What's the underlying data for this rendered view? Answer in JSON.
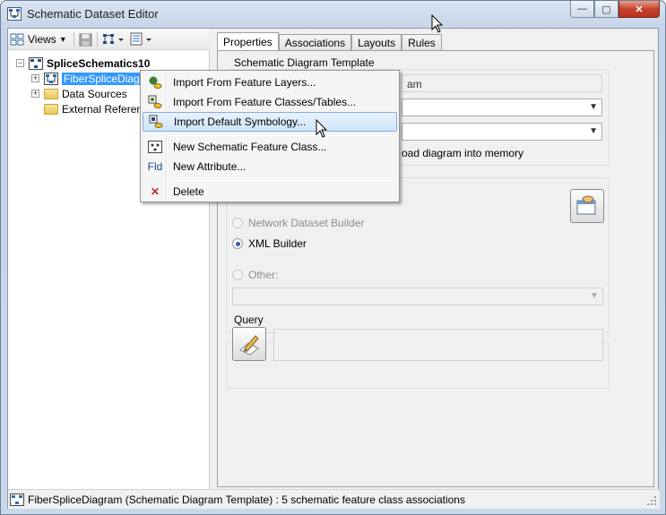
{
  "window": {
    "title": "Schematic Dataset Editor",
    "buttons": {
      "minimize": "—",
      "maximize": "▢",
      "close": "✕"
    }
  },
  "toolbar": {
    "views_label": "Views",
    "views_arrow": "▾"
  },
  "tree": {
    "root": "SpliceSchematics10",
    "items": [
      {
        "label": "FiberSpliceDiagram",
        "expander": "+"
      },
      {
        "label": "Data Sources",
        "expander": "+"
      },
      {
        "label": "External References"
      }
    ]
  },
  "tabs": [
    "Properties",
    "Associations",
    "Layouts",
    "Rules"
  ],
  "properties": {
    "template_group_label": "Schematic Diagram Template",
    "name_field_visible": "am",
    "load_memory_visible": "oad diagram into memory",
    "builders": {
      "network": "Network Dataset Builder",
      "xml": "XML Builder",
      "other": "Other:"
    },
    "query_label": "Query"
  },
  "context_menu": {
    "items": [
      {
        "label": "Import From Feature Layers...",
        "icon": "import-layers-icon"
      },
      {
        "label": "Import From Feature Classes/Tables...",
        "icon": "import-classes-icon"
      },
      {
        "label": "Import Default Symbology...",
        "icon": "import-symbology-icon"
      },
      {
        "label": "New Schematic Feature Class...",
        "icon": "feature-class-icon"
      },
      {
        "label": "New Attribute...",
        "icon": "fld-icon",
        "icon_text": "Fld"
      },
      {
        "label": "Delete",
        "icon": "delete-icon",
        "icon_text": "✕"
      }
    ]
  },
  "statusbar": {
    "text": "FiberSpliceDiagram (Schematic Diagram Template) : 5 schematic feature class associations"
  },
  "colors": {
    "selection": "#3399ff",
    "menu_hover": "#cfe5fb",
    "delete": "#c0282d"
  }
}
